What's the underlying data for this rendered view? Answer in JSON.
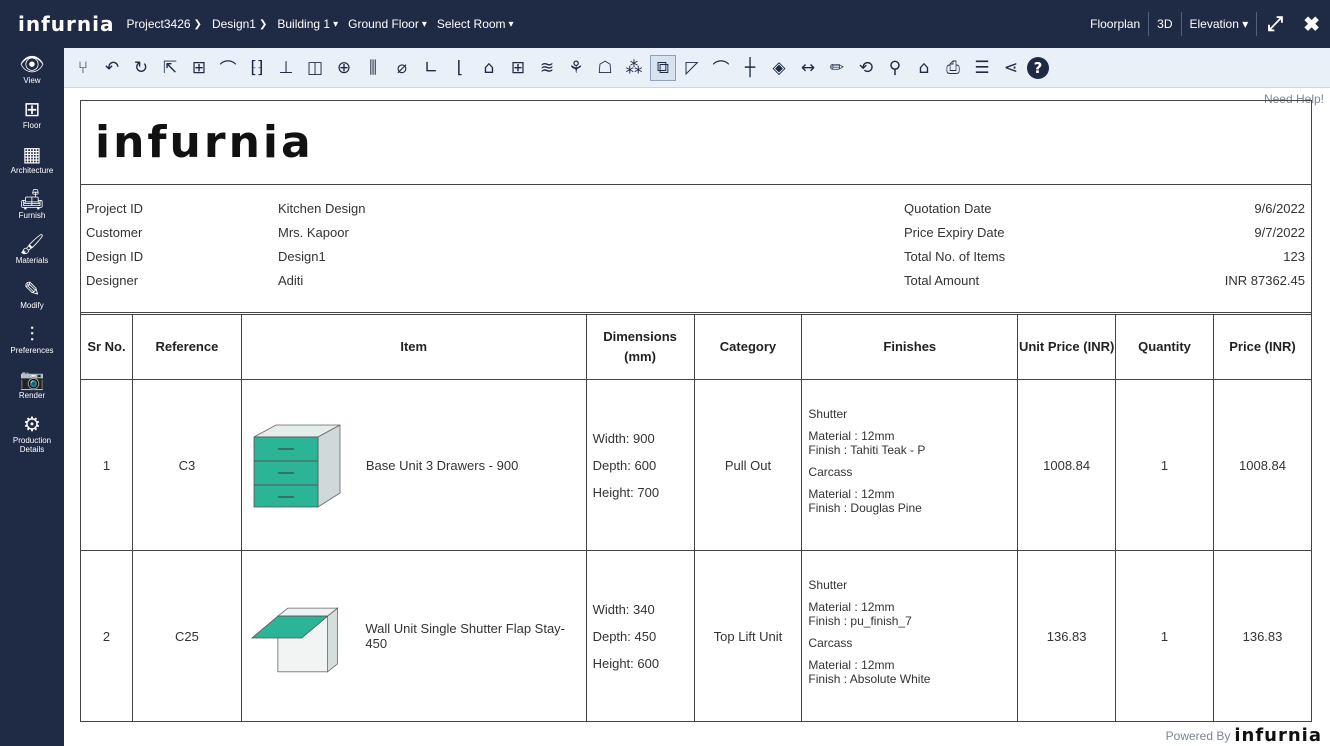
{
  "topbar": {
    "logo": "infurnia",
    "breadcrumbs": [
      {
        "label": "Project3426",
        "sep": "❯"
      },
      {
        "label": "Design1",
        "sep": "❯"
      },
      {
        "label": "Building 1",
        "sep": "▾"
      },
      {
        "label": "Ground Floor",
        "sep": "▾"
      },
      {
        "label": "Select Room",
        "sep": "▾"
      }
    ],
    "floorplan": "Floorplan",
    "threed": "3D",
    "elevation": "Elevation ▾",
    "expand_icon": "expand-icon",
    "close_icon": "close-icon"
  },
  "sidebar": {
    "items": [
      {
        "label": "View",
        "icon": "👁",
        "name": "view"
      },
      {
        "label": "Floor",
        "icon": "⊞",
        "name": "floor"
      },
      {
        "label": "Architecture",
        "icon": "▦",
        "name": "architecture"
      },
      {
        "label": "Furnish",
        "icon": "🛋",
        "name": "furnish"
      },
      {
        "label": "Materials",
        "icon": "🖌",
        "name": "materials"
      },
      {
        "label": "Modify",
        "icon": "✎",
        "name": "modify"
      },
      {
        "label": "Preferences",
        "icon": "⫶",
        "name": "preferences"
      },
      {
        "label": "Render",
        "icon": "📷",
        "name": "render"
      },
      {
        "label": "Production Details",
        "icon": "⚙",
        "name": "production-details"
      }
    ]
  },
  "toolbar": {
    "tools": [
      {
        "glyph": "⑂",
        "name": "branch-icon"
      },
      {
        "glyph": "↶",
        "name": "undo-icon"
      },
      {
        "glyph": "↻",
        "name": "redo-icon"
      },
      {
        "glyph": "⇱",
        "name": "select-icon"
      },
      {
        "glyph": "⊞",
        "name": "grid-icon"
      },
      {
        "glyph": "⌒",
        "name": "arc-wall-icon"
      },
      {
        "glyph": "⁅⁆",
        "name": "bracket-icon"
      },
      {
        "glyph": "⊥",
        "name": "table-icon"
      },
      {
        "glyph": "◫",
        "name": "cabinet-icon"
      },
      {
        "glyph": "⊕",
        "name": "window-icon"
      },
      {
        "glyph": "⫼",
        "name": "column-icon"
      },
      {
        "glyph": "⌀",
        "name": "erase-icon"
      },
      {
        "glyph": "∟",
        "name": "corner-icon"
      },
      {
        "glyph": "⌊",
        "name": "l-shape-icon"
      },
      {
        "glyph": "⌂",
        "name": "house-icon"
      },
      {
        "glyph": "⊞",
        "name": "blocks-icon"
      },
      {
        "glyph": "≋",
        "name": "layers-icon"
      },
      {
        "glyph": "⚘",
        "name": "figure-icon"
      },
      {
        "glyph": "☖",
        "name": "bulb-icon"
      },
      {
        "glyph": "⁂",
        "name": "pattern-icon"
      },
      {
        "glyph": "⧉",
        "name": "import-icon",
        "boxed": true
      },
      {
        "glyph": "◸",
        "name": "shape-icon"
      },
      {
        "glyph": "⌒",
        "name": "arch-icon"
      },
      {
        "glyph": "┼",
        "name": "cross-icon"
      },
      {
        "glyph": "◈",
        "name": "diamond-icon"
      },
      {
        "glyph": "↔",
        "name": "dimension-icon"
      },
      {
        "glyph": "✏",
        "name": "pencil-icon"
      },
      {
        "glyph": "⟲",
        "name": "paint-icon"
      },
      {
        "glyph": "⚲",
        "name": "search-icon"
      },
      {
        "glyph": "⌂",
        "name": "home-icon"
      },
      {
        "glyph": "⎙",
        "name": "export-icon"
      },
      {
        "glyph": "☰",
        "name": "comment-icon"
      },
      {
        "glyph": "⋖",
        "name": "share-icon"
      },
      {
        "glyph": "?",
        "name": "help-icon",
        "help": true
      }
    ]
  },
  "content": {
    "need_help": "Need Help!",
    "doc_logo": "infurnia",
    "info_left": [
      {
        "k": "Project ID",
        "v": "Kitchen Design"
      },
      {
        "k": "Customer",
        "v": "Mrs. Kapoor"
      },
      {
        "k": "Design ID",
        "v": "Design1"
      },
      {
        "k": "Designer",
        "v": "Aditi"
      }
    ],
    "info_right": [
      {
        "k": "Quotation Date",
        "v": "9/6/2022"
      },
      {
        "k": "Price Expiry Date",
        "v": "9/7/2022"
      },
      {
        "k": "Total No. of Items",
        "v": "123"
      },
      {
        "k": "Total Amount",
        "v": "INR 87362.45"
      }
    ],
    "table_headers": [
      "Sr No.",
      "Reference",
      "Item",
      "Dimensions (mm)",
      "Category",
      "Finishes",
      "Unit Price (INR)",
      "Quantity",
      "Price (INR)"
    ],
    "rows": [
      {
        "sr": "1",
        "ref": "C3",
        "item": "Base Unit 3 Drawers - 900",
        "width": "Width: 900",
        "depth": "Depth: 600",
        "height": "Height: 700",
        "category": "Pull Out",
        "f1": "Shutter",
        "f2": "Material : 12mm",
        "f3": "Finish : Tahiti Teak - P",
        "f4": "Carcass",
        "f5": "Material : 12mm",
        "f6": "Finish : Douglas Pine",
        "unit_price": "1008.84",
        "qty": "1",
        "price": "1008.84"
      },
      {
        "sr": "2",
        "ref": "C25",
        "item": "Wall Unit Single Shutter Flap Stay-450",
        "width": "Width: 340",
        "depth": "Depth: 450",
        "height": "Height: 600",
        "category": "Top Lift Unit",
        "f1": "Shutter",
        "f2": "Material : 12mm",
        "f3": "Finish : pu_finish_7",
        "f4": "Carcass",
        "f5": "Material : 12mm",
        "f6": "Finish : Absolute White",
        "unit_price": "136.83",
        "qty": "1",
        "price": "136.83"
      }
    ],
    "powered_by": "Powered By",
    "powered_logo": "infurnia"
  }
}
